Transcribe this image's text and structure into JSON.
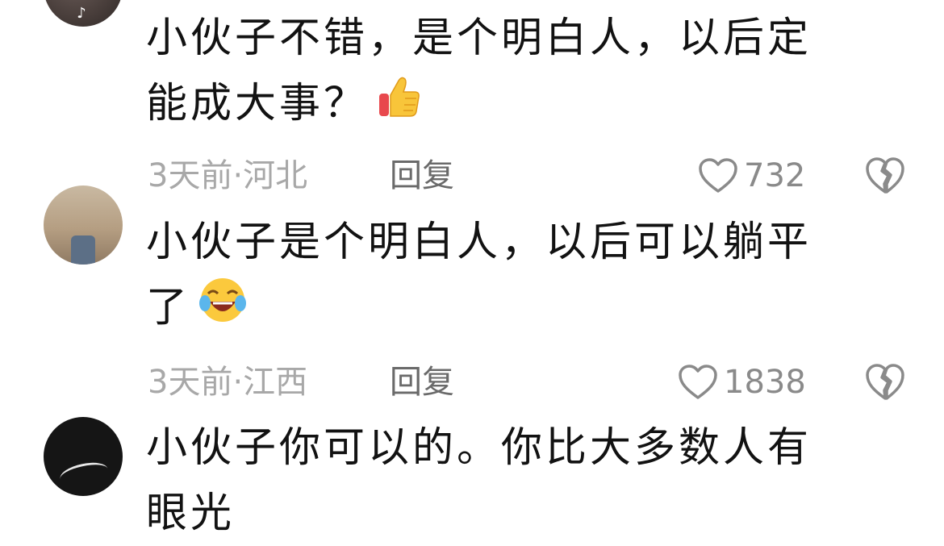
{
  "comments": [
    {
      "avatar_icon": "tiktok-logo-icon",
      "text_line1": "小伙子不错，是个明白人，以后定",
      "text_line2": "能成大事？",
      "emoji": "thumbs-up-emoji",
      "meta": "3天前·河北",
      "reply_label": "回复",
      "like_count": "732"
    },
    {
      "text_line1": "小伙子是个明白人，以后可以躺平",
      "text_line2": "了",
      "emoji": "laughing-crying-emoji",
      "meta": "3天前·江西",
      "reply_label": "回复",
      "like_count": "1838"
    },
    {
      "text_line1": "小伙子你可以的。你比大多数人有",
      "text_line2": "眼光"
    }
  ],
  "colors": {
    "text": "#121212",
    "meta": "#a8a8a8",
    "reply": "#6a6a6a",
    "icon": "#8a8a8a"
  }
}
